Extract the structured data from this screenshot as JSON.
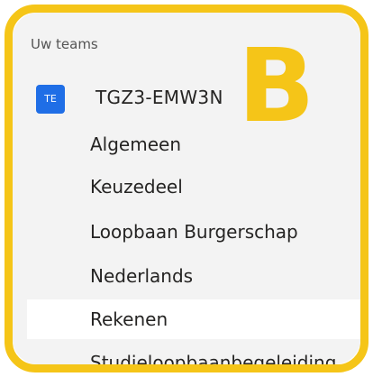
{
  "sidebar": {
    "section_title": "Uw teams",
    "team": {
      "avatar_text": "TE",
      "name": "TGZ3-EMW3N"
    },
    "channels": [
      {
        "label": "Algemeen",
        "active": false
      },
      {
        "label": "Keuzedeel",
        "active": false
      },
      {
        "label": "Loopbaan Burgerschap",
        "active": false
      },
      {
        "label": "Nederlands",
        "active": false
      },
      {
        "label": "Rekenen",
        "active": true
      },
      {
        "label": "Studieloopbaanbegeleiding",
        "active": false
      }
    ]
  },
  "overlay": {
    "marker_letter": "B",
    "highlight_color": "#f5c518"
  },
  "colors": {
    "avatar_bg": "#1f6ee6",
    "panel_bg": "#f3f3f3",
    "active_row_bg": "#ffffff"
  }
}
